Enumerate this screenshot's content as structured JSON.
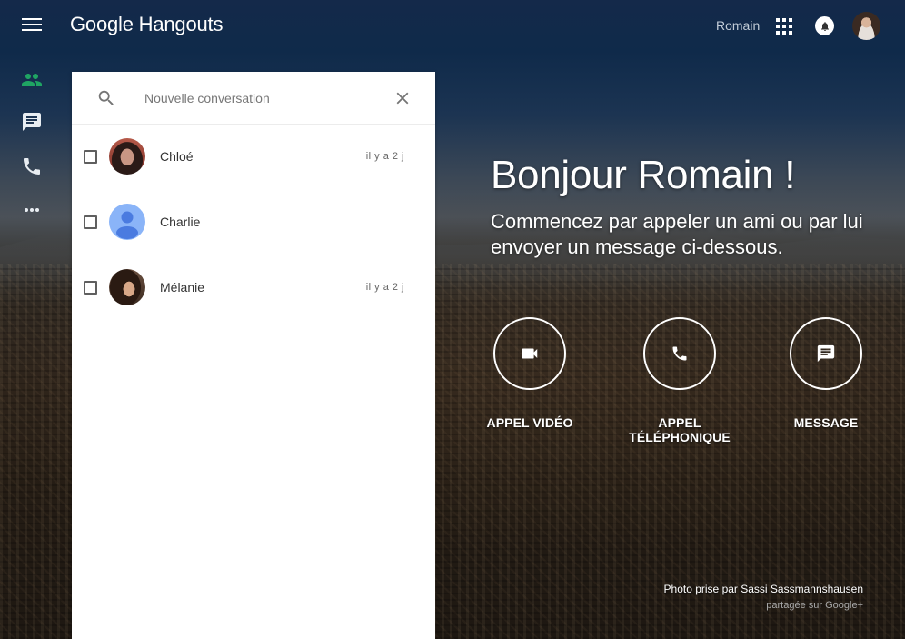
{
  "app": {
    "logo_google": "Google",
    "logo_product": "Hangouts",
    "user_name": "Romain"
  },
  "colors": {
    "accent_green": "#1fa463",
    "default_avatar_bg": "#8ab4f8",
    "default_avatar_fg": "#4a7be0"
  },
  "rail": [
    {
      "icon": "people-icon",
      "active": true
    },
    {
      "icon": "chat-icon",
      "active": false
    },
    {
      "icon": "phone-icon",
      "active": false
    },
    {
      "icon": "more-icon",
      "active": false
    }
  ],
  "panel": {
    "search_placeholder": "Nouvelle conversation",
    "contacts": [
      {
        "name": "Chloé",
        "time": "il y a 2 j",
        "avatar": "photo"
      },
      {
        "name": "Charlie",
        "time": "",
        "avatar": "default"
      },
      {
        "name": "Mélanie",
        "time": "il y a 2 j",
        "avatar": "photo"
      }
    ]
  },
  "main": {
    "greeting": "Bonjour Romain !",
    "subtitle": "Commencez par appeler un ami ou par lui envoyer un message ci-dessous.",
    "actions": [
      {
        "label": "APPEL VIDÉO",
        "icon": "video-camera-icon"
      },
      {
        "label": "APPEL TÉLÉPHONIQUE",
        "icon": "phone-icon"
      },
      {
        "label": "MESSAGE",
        "icon": "message-icon"
      }
    ],
    "photo_credit": "Photo prise par Sassi Sassmannshausen",
    "photo_source": "partagée sur Google+"
  }
}
